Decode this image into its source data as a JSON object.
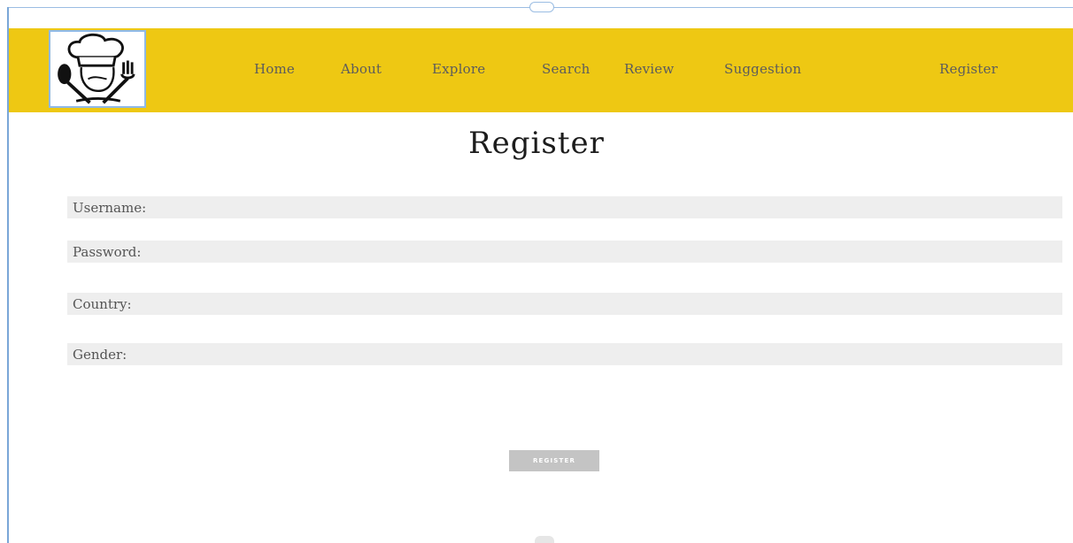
{
  "nav": {
    "items": [
      {
        "label": "Home"
      },
      {
        "label": "About"
      },
      {
        "label": "Explore"
      },
      {
        "label": "Search"
      },
      {
        "label": "Review"
      },
      {
        "label": "Suggestion"
      },
      {
        "label": "Register"
      }
    ]
  },
  "page": {
    "title": "Register"
  },
  "form": {
    "fields": [
      {
        "label": "Username:",
        "value": ""
      },
      {
        "label": "Password:",
        "value": ""
      },
      {
        "label": "Country:",
        "value": ""
      },
      {
        "label": "Gender:",
        "value": ""
      }
    ],
    "submit_label": "REGISTER"
  },
  "colors": {
    "header_bg": "#eec813",
    "nav_text": "#5c5c5c",
    "field_bg": "#eeeeee",
    "button_bg": "#c4c4c4"
  },
  "icons": {
    "logo": "chef-logo-icon"
  }
}
